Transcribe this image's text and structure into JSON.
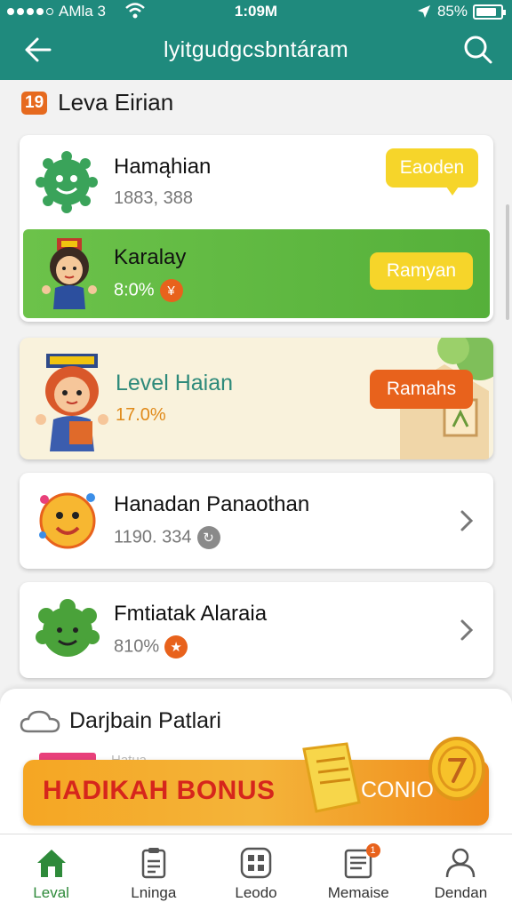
{
  "status": {
    "carrier": "AMla 3",
    "time": "1:09M",
    "battery": "85%"
  },
  "header": {
    "title": "lyitgudgcsbntáram"
  },
  "section": {
    "badge": "19",
    "title": "Leva Eirian"
  },
  "items": [
    {
      "name": "Hamąhian",
      "sub": "1883, 388",
      "action": "Eaoden"
    },
    {
      "name": "Karalay",
      "sub": "8:0%",
      "action": "Ramyan"
    },
    {
      "name": "Level Haian",
      "sub": "17.0%",
      "action": "Ramahs"
    },
    {
      "name": "Hanadan Panaothan",
      "sub": "1190. 334"
    },
    {
      "name": "Fmtiatak Alaraia",
      "sub": "810%"
    }
  ],
  "sheet": {
    "title": "Darjbain Patlari",
    "faint": "Hatua"
  },
  "bonus": {
    "text": "HADIKAH BONUS",
    "coin": "CONIO"
  },
  "nav": [
    {
      "label": "Leval",
      "icon": "home-icon"
    },
    {
      "label": "Lninga",
      "icon": "clipboard-icon"
    },
    {
      "label": "Leodo",
      "icon": "grid-icon"
    },
    {
      "label": "Memaise",
      "icon": "note-icon",
      "badge": "1"
    },
    {
      "label": "Dendan",
      "icon": "person-icon"
    }
  ],
  "colors": {
    "header": "#1f8a7d",
    "green": "#5bb841",
    "orange": "#e8621c",
    "yellow": "#f6d52a"
  }
}
